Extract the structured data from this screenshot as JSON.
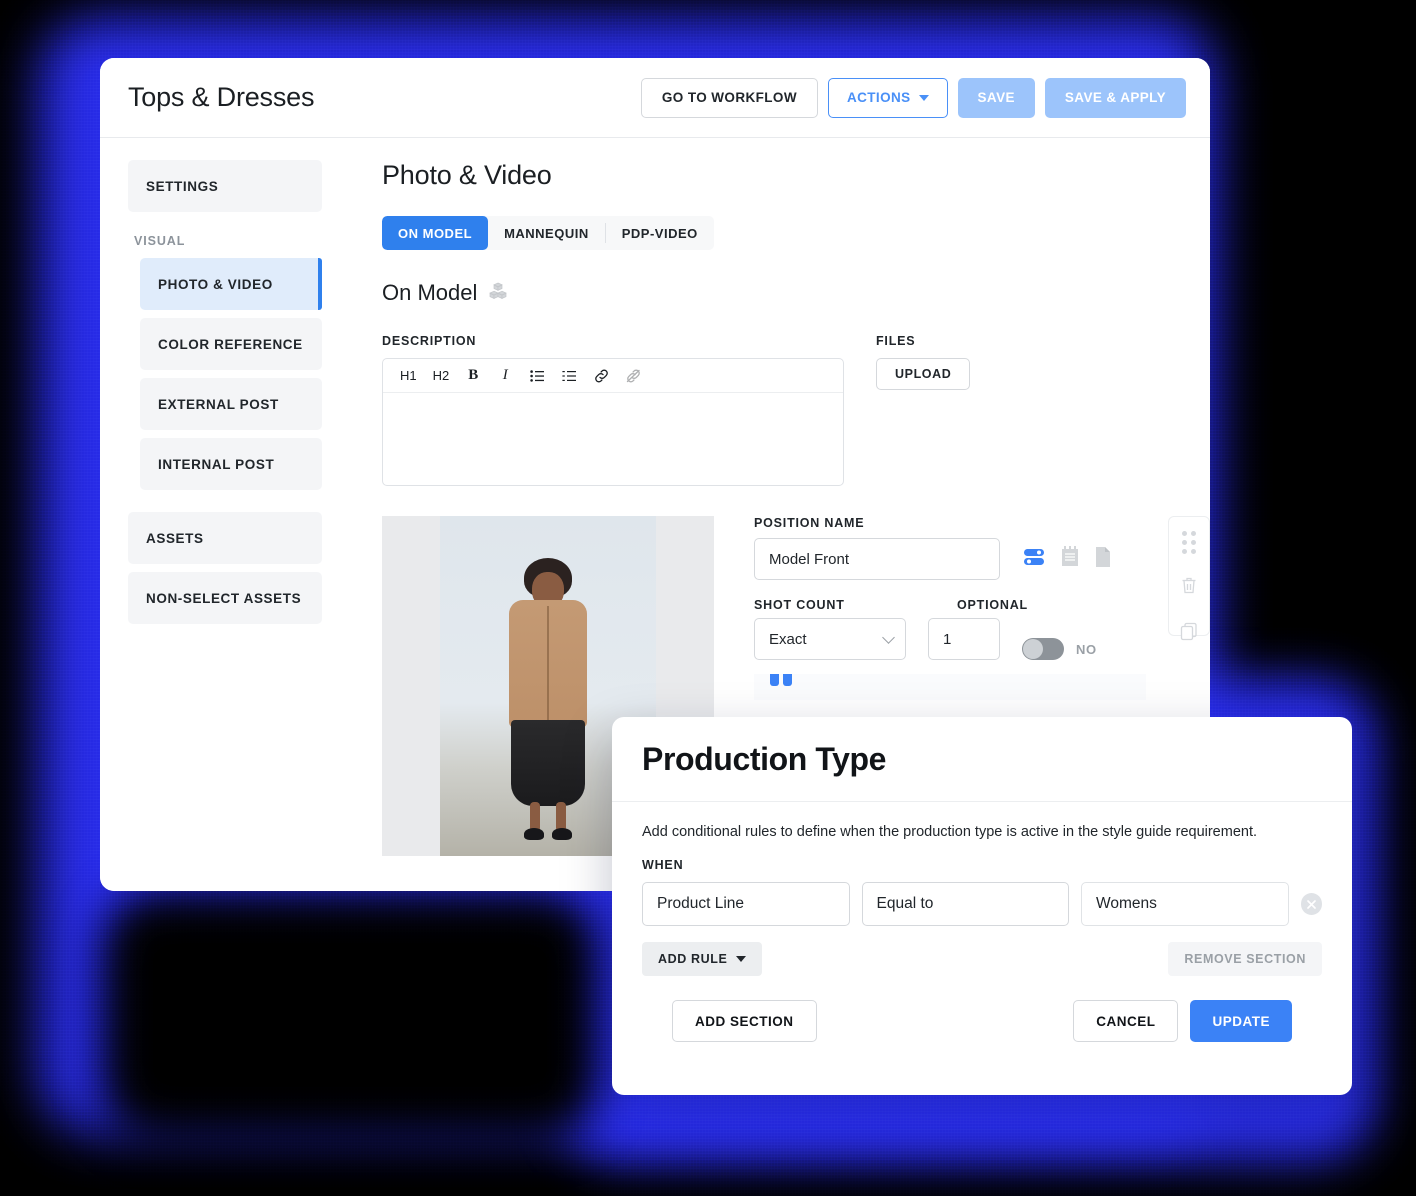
{
  "header": {
    "title": "Tops & Dresses",
    "go_to_workflow": "GO TO WORKFLOW",
    "actions": "ACTIONS",
    "save": "SAVE",
    "save_apply": "SAVE & APPLY"
  },
  "sidebar": {
    "settings": "SETTINGS",
    "visual_group": "VISUAL",
    "visual_items": [
      {
        "label": "PHOTO & VIDEO",
        "active": true
      },
      {
        "label": "COLOR REFERENCE",
        "active": false
      },
      {
        "label": "EXTERNAL POST",
        "active": false
      },
      {
        "label": "INTERNAL POST",
        "active": false
      }
    ],
    "assets": "ASSETS",
    "non_select_assets": "NON-SELECT ASSETS"
  },
  "main": {
    "title": "Photo & Video",
    "tabs": [
      {
        "label": "ON MODEL",
        "active": true
      },
      {
        "label": "MANNEQUIN",
        "active": false
      },
      {
        "label": "PDP-VIDEO",
        "active": false
      }
    ],
    "section_heading": "On Model",
    "section_icon": "cubes-icon",
    "description_label": "DESCRIPTION",
    "description_value": "",
    "files_label": "FILES",
    "upload_label": "UPLOAD",
    "toolbar": {
      "h1": "H1",
      "h2": "H2",
      "bold": "B",
      "italic": "I",
      "bullet_list": "bullet-list-icon",
      "numbered_list": "numbered-list-icon",
      "link": "link-icon",
      "unlink": "unlink-icon"
    },
    "position": {
      "position_name_label": "POSITION NAME",
      "position_name_value": "Model Front",
      "shot_count_label": "SHOT COUNT",
      "shot_count_type": "Exact",
      "shot_count_value": "1",
      "optional_label": "OPTIONAL",
      "optional_value": "NO",
      "icons": [
        "production-type-icon",
        "notepad-icon",
        "document-icon"
      ],
      "rail_icons": [
        "drag-handle-icon",
        "trash-icon",
        "duplicate-icon"
      ]
    }
  },
  "modal": {
    "title": "Production Type",
    "description": "Add conditional rules to define when the production type is active in the style guide requirement.",
    "when_label": "WHEN",
    "rule": {
      "field": "Product Line",
      "operator": "Equal to",
      "value": "Womens",
      "remove_icon": "remove-rule-icon"
    },
    "add_rule": "ADD RULE",
    "remove_section": "REMOVE SECTION",
    "add_section": "ADD SECTION",
    "cancel": "CANCEL",
    "update": "UPDATE"
  },
  "colors": {
    "accent_blue": "#2f80ed",
    "primary_blue": "#3b82f6",
    "soft_blue": "#9cc4fb",
    "glow_blue": "#2a2ef5",
    "background": "#000000"
  }
}
